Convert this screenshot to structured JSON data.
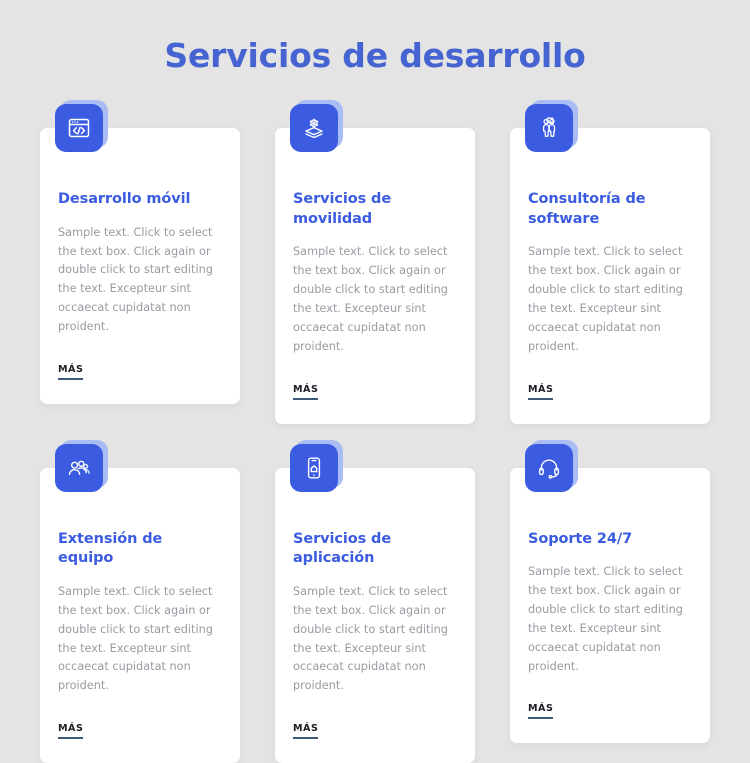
{
  "page": {
    "title": "Servicios de desarrollo",
    "background_color": "#e4e4e4",
    "accent_color": "#3b5ce0",
    "title_color": "#4563d1",
    "card_background": "#ffffff",
    "body_text_color": "#9a9aa2",
    "more_underline_color": "#3e5878"
  },
  "cards": [
    {
      "icon": "code-window-icon",
      "title": "Desarrollo móvil",
      "body": "Sample text. Click to select the text box. Click again or double click to start editing the text. Excepteur sint occaecat cupidatat non proident.",
      "more_label": "MÁS"
    },
    {
      "icon": "layers-gear-icon",
      "title": "Servicios de movilidad",
      "body": "Sample text. Click to select the text box. Click again or double click to start editing the text. Excepteur sint occaecat cupidatat non proident.",
      "more_label": "MÁS"
    },
    {
      "icon": "consulting-people-icon",
      "title": "Consultoría de software",
      "body": "Sample text. Click to select the text box. Click again or double click to start editing the text. Excepteur sint occaecat cupidatat non proident.",
      "more_label": "MÁS"
    },
    {
      "icon": "team-group-icon",
      "title": "Extensión de equipo",
      "body": "Sample text. Click to select the text box. Click again or double click to start editing the text. Excepteur sint occaecat cupidatat non proident.",
      "more_label": "MÁS"
    },
    {
      "icon": "smartphone-app-icon",
      "title": "Servicios de aplicación",
      "body": "Sample text. Click to select the text box. Click again or double click to start editing the text. Excepteur sint occaecat cupidatat non proident.",
      "more_label": "MÁS"
    },
    {
      "icon": "headset-support-icon",
      "title": "Soporte 24/7",
      "body": "Sample text. Click to select the text box. Click again or double click to start editing the text. Excepteur sint occaecat cupidatat non proident.",
      "more_label": "MÁS"
    }
  ]
}
